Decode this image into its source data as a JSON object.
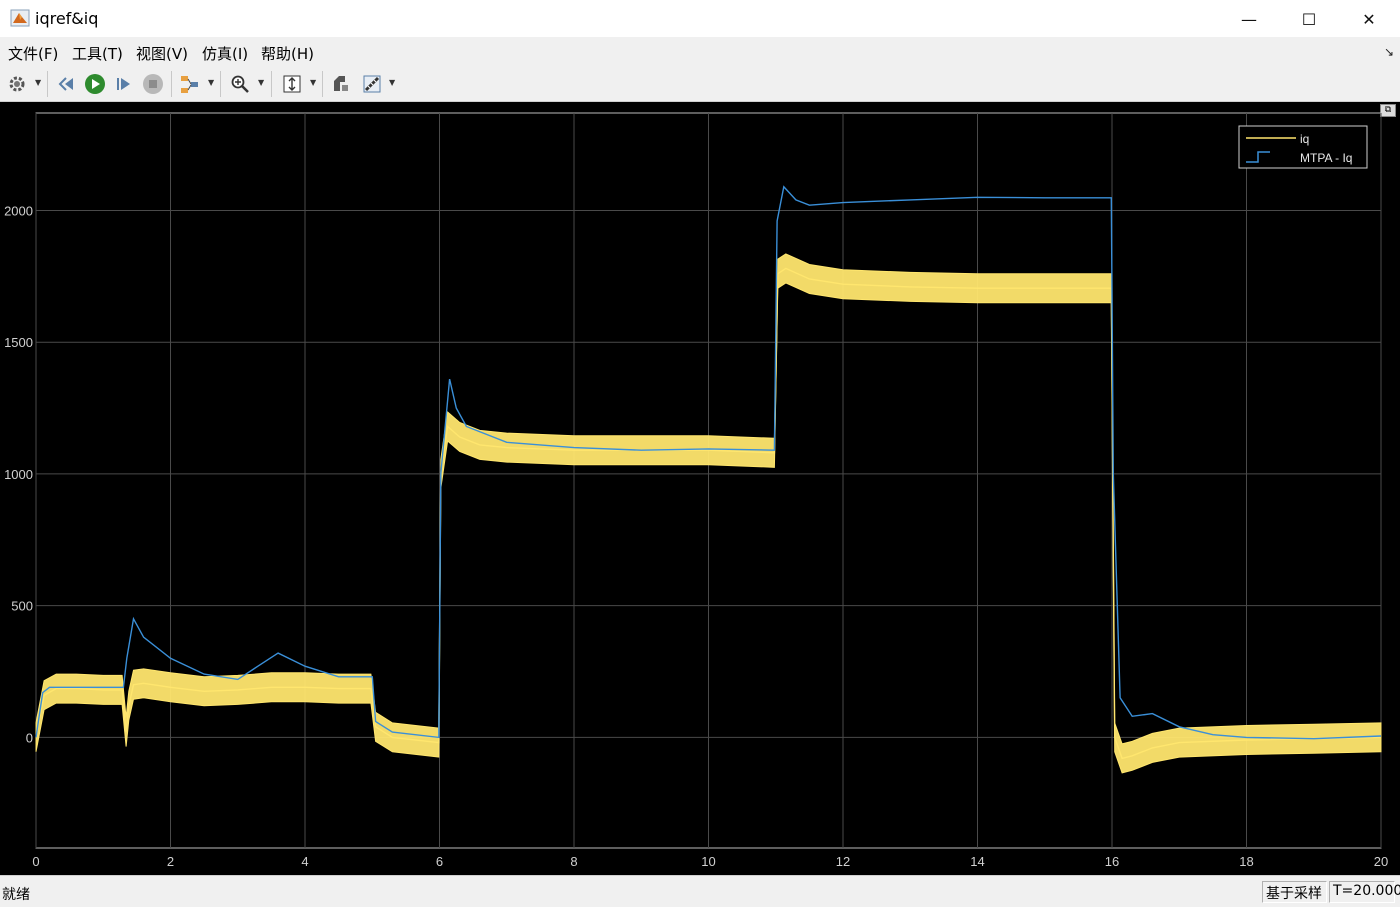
{
  "window": {
    "title": "iqref&iq",
    "minimize_glyph": "—",
    "maximize_glyph": "☐",
    "close_glyph": "✕"
  },
  "menu": {
    "items": [
      "文件(F)",
      "工具(T)",
      "视图(V)",
      "仿真(I)",
      "帮助(H)"
    ],
    "collapse_glyph": "↘"
  },
  "toolbar": {
    "icons": [
      "gear-icon",
      "step-back-icon",
      "run-icon",
      "step-forward-icon",
      "stop-icon",
      "highlight-block-icon",
      "zoom-icon",
      "autoscale-icon",
      "style-icon",
      "measure-icon"
    ]
  },
  "status": {
    "text": "就绪",
    "mode": "基于采样",
    "time": "T=20.000"
  },
  "chart_data": {
    "type": "line",
    "xlim": [
      0,
      20
    ],
    "ylim": [
      -420,
      2370
    ],
    "xticks": [
      0,
      2,
      4,
      6,
      8,
      10,
      12,
      14,
      16,
      18,
      20
    ],
    "yticks": [
      0,
      500,
      1000,
      1500,
      2000
    ],
    "grid": true,
    "background": "#000000",
    "legend": {
      "position": "top-right",
      "entries": [
        "iq",
        "MTPA - Iq"
      ]
    },
    "series": [
      {
        "name": "iq",
        "color": "#FFE66E",
        "x": [
          0,
          0.12,
          0.3,
          0.6,
          1.0,
          1.28,
          1.34,
          1.38,
          1.45,
          1.6,
          2.0,
          2.5,
          3.0,
          3.5,
          4.0,
          4.5,
          4.98,
          5.05,
          5.3,
          5.99,
          6.02,
          6.12,
          6.3,
          6.6,
          7.0,
          8.0,
          9.0,
          10.0,
          10.98,
          11.03,
          11.15,
          11.5,
          12.0,
          13.0,
          14.0,
          15.0,
          15.99,
          16.04,
          16.15,
          16.3,
          16.6,
          17.0,
          18.0,
          19.0,
          20.0
        ],
        "y": [
          0,
          160,
          185,
          185,
          180,
          180,
          20,
          120,
          200,
          205,
          190,
          175,
          180,
          190,
          190,
          185,
          185,
          40,
          0,
          -20,
          1000,
          1180,
          1140,
          1110,
          1100,
          1090,
          1090,
          1090,
          1080,
          1760,
          1780,
          1740,
          1720,
          1710,
          1705,
          1705,
          1705,
          0,
          -80,
          -70,
          -40,
          -20,
          -10,
          -5,
          0
        ],
        "band": 55
      },
      {
        "name": "MTPA - Iq",
        "color": "#3A8FD8",
        "x": [
          0,
          0.1,
          0.2,
          0.5,
          1.0,
          1.3,
          1.35,
          1.45,
          1.6,
          2.0,
          2.5,
          3.0,
          3.3,
          3.6,
          4.0,
          4.5,
          5.0,
          5.05,
          5.3,
          5.99,
          6.02,
          6.15,
          6.25,
          6.4,
          7.0,
          8.0,
          9.0,
          10.0,
          10.98,
          11.02,
          11.12,
          11.3,
          11.5,
          12.0,
          13.0,
          14.0,
          15.0,
          15.99,
          16.02,
          16.12,
          16.3,
          16.6,
          17.0,
          17.5,
          18.0,
          19.0,
          20.0
        ],
        "y": [
          0,
          170,
          190,
          190,
          190,
          190,
          300,
          450,
          380,
          300,
          240,
          220,
          270,
          320,
          270,
          230,
          230,
          60,
          20,
          0,
          1000,
          1360,
          1250,
          1180,
          1120,
          1100,
          1090,
          1095,
          1090,
          1960,
          2090,
          2040,
          2020,
          2030,
          2040,
          2050,
          2048,
          2048,
          1000,
          150,
          80,
          90,
          40,
          10,
          0,
          -5,
          5
        ]
      }
    ]
  }
}
